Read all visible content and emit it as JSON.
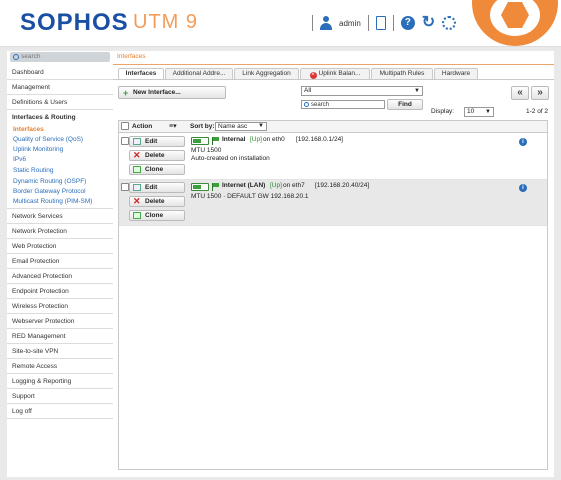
{
  "header": {
    "logo": "SOPHOS",
    "product": "UTM 9",
    "user": "admin",
    "icons": [
      "user-icon",
      "clipboard-icon",
      "help-icon",
      "reload-icon",
      "activity-icon"
    ]
  },
  "sidebar": {
    "search_placeholder": "search",
    "items": [
      "Dashboard",
      "Management",
      "Definitions & Users",
      "Interfaces & Routing",
      "Network Services",
      "Network Protection",
      "Web Protection",
      "Email Protection",
      "Advanced Protection",
      "Endpoint Protection",
      "Wireless Protection",
      "Webserver Protection",
      "RED Management",
      "Site-to-site VPN",
      "Remote Access",
      "Logging & Reporting",
      "Support",
      "Log off"
    ],
    "subitems": [
      "Interfaces",
      "Quality of Service (QoS)",
      "Uplink Monitoring",
      "IPv6",
      "Static Routing",
      "Dynamic Routing (OSPF)",
      "Border Gateway Protocol",
      "Multicast Routing (PIM-SM)"
    ]
  },
  "main": {
    "breadcrumb": "Interfaces",
    "tabs": [
      "Interfaces",
      "Additional Addre...",
      "Link Aggregation",
      "Uplink Balan...",
      "Multipath Rules",
      "Hardware"
    ],
    "new_button": "New Interface...",
    "filter_value": "All",
    "search_placeholder": "search",
    "find_label": "Find",
    "display_label": "Display:",
    "display_value": "10",
    "page_count": "1-2 of 2",
    "prev_glyph": "«",
    "next_glyph": "»",
    "list_header": {
      "action": "Action",
      "sort_by": "Sort by:",
      "sort_value": "Name asc"
    },
    "action_labels": {
      "edit": "Edit",
      "delete": "Delete",
      "clone": "Clone"
    },
    "rows": [
      {
        "name": "Internal",
        "status": "[Up]",
        "on": "on eth0",
        "address": "[192.168.0.1/24]",
        "mtu": "MTU 1500",
        "comment": "Auto-created on installation"
      },
      {
        "name": "Internet (LAN)",
        "status": "[Up]",
        "on": "on eth7",
        "address": "[192.168.20.40/24]",
        "mtu": "MTU 1500 · DEFAULT GW 192.168.20.1"
      }
    ]
  },
  "colors": {
    "accent": "#e8802e",
    "brand": "#1a4fa3",
    "link": "#2a6ebb",
    "up": "#2a8a2a"
  }
}
